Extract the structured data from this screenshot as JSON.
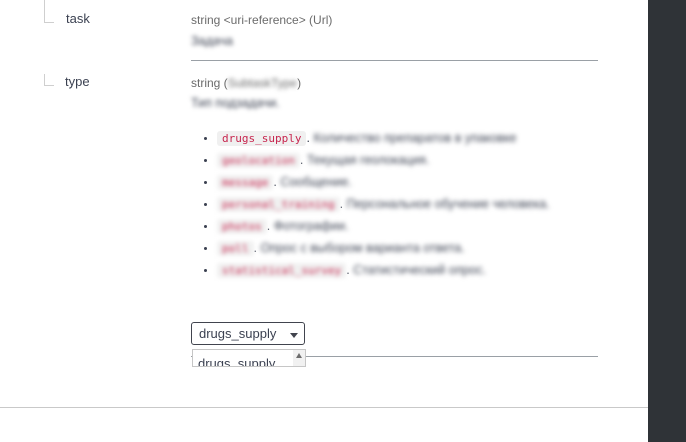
{
  "properties": [
    {
      "name": "task",
      "type_text": "string <uri-reference> (Url)",
      "description": "Задача"
    },
    {
      "name": "type",
      "type_prefix": "string (",
      "type_name": "SubtaskType",
      "type_suffix": ")",
      "description": "Тип подзадачи.",
      "enum": [
        {
          "code": "drugs_supply",
          "text": "Количество препаратов в упаковке"
        },
        {
          "code": "geolocation",
          "text": "Текущая геолокация."
        },
        {
          "code": "message",
          "text": "Сообщение."
        },
        {
          "code": "personal_training",
          "text": "Персональное обучение человека."
        },
        {
          "code": "photos",
          "text": "Фотографии."
        },
        {
          "code": "poll",
          "text": "Опрос с выбором варианта ответа."
        },
        {
          "code": "statistical_survey",
          "text": "Статистический опрос."
        }
      ],
      "select_value": "drugs_supply",
      "listbox_option": "drugs_supply"
    }
  ]
}
